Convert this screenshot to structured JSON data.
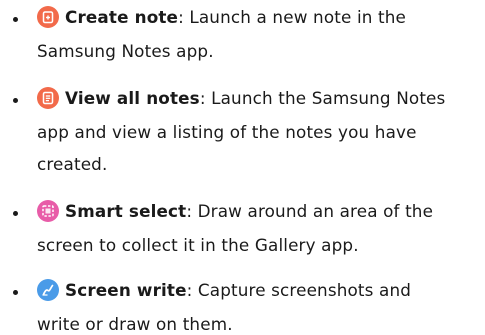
{
  "items": [
    {
      "icon": "create-note-icon",
      "term": "Create note",
      "line1": ": Launch a new note in the",
      "line2": "Samsung Notes app.",
      "line3": ""
    },
    {
      "icon": "view-all-notes-icon",
      "term": "View all notes",
      "line1": ": Launch the Samsung Notes",
      "line2": "app and view a listing of the notes you have",
      "line3": "created."
    },
    {
      "icon": "smart-select-icon",
      "term": "Smart select",
      "line1": ": Draw around an area of the",
      "line2": "screen to collect it in the Gallery app.",
      "line3": ""
    },
    {
      "icon": "screen-write-icon",
      "term": "Screen write",
      "line1": ": Capture screenshots and",
      "line2": "write or draw on them.",
      "line3": ""
    }
  ],
  "colors": {
    "create_note": "#f26a4a",
    "view_all_notes": "#f26a4a",
    "smart_select": "#e85ca8",
    "screen_write": "#4a9be8",
    "text": "#1a1a1a"
  }
}
